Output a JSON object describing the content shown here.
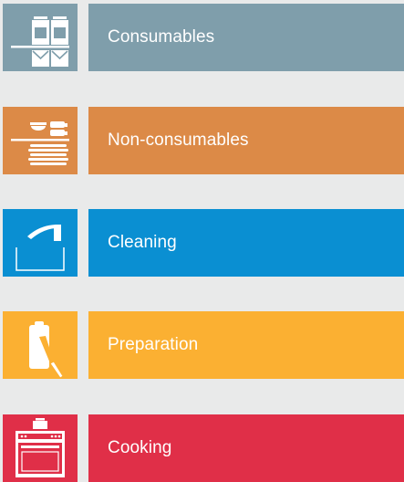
{
  "categories": [
    {
      "id": "consumables",
      "label": "Consumables",
      "color": "#7f9eab",
      "icon": "food-jars-icon"
    },
    {
      "id": "non-consumables",
      "label": "Non-consumables",
      "color": "#dc8a47",
      "icon": "dishes-stack-icon"
    },
    {
      "id": "cleaning",
      "label": "Cleaning",
      "color": "#0a8fd2",
      "icon": "faucet-sink-icon"
    },
    {
      "id": "preparation",
      "label": "Preparation",
      "color": "#fbb032",
      "icon": "cutting-board-knife-icon"
    },
    {
      "id": "cooking",
      "label": "Cooking",
      "color": "#e02f48",
      "icon": "stove-oven-icon"
    }
  ]
}
